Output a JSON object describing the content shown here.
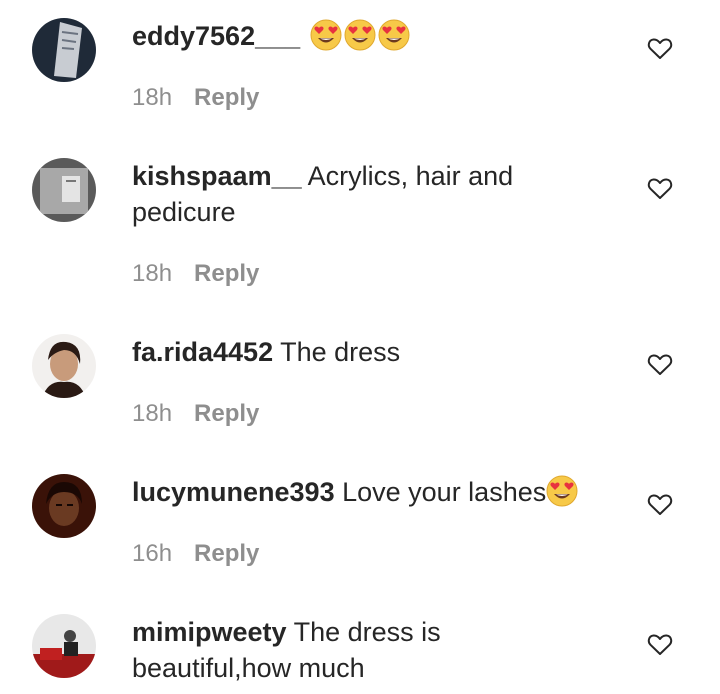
{
  "comments": [
    {
      "username": "eddy7562___",
      "text": "",
      "emojis": [
        "heart-eyes",
        "heart-eyes",
        "heart-eyes"
      ],
      "time": "18h",
      "reply_label": "Reply"
    },
    {
      "username": "kishspaam__",
      "text": "Acrylics, hair and",
      "text2": "pedicure",
      "time": "18h",
      "reply_label": "Reply"
    },
    {
      "username": "fa.rida4452",
      "text": "The dress",
      "time": "18h",
      "reply_label": "Reply"
    },
    {
      "username": "lucymunene393",
      "text": "Love your lashes",
      "emojis": [
        "heart-eyes"
      ],
      "time": "16h",
      "reply_label": "Reply"
    },
    {
      "username": "mimipweety",
      "text": "The dress is",
      "text2": "beautiful,how much"
    }
  ],
  "colors": {
    "text": "#262626",
    "muted": "#8e8e8e",
    "emoji": "#f7c948",
    "emoji_heart": "#e8323f"
  }
}
